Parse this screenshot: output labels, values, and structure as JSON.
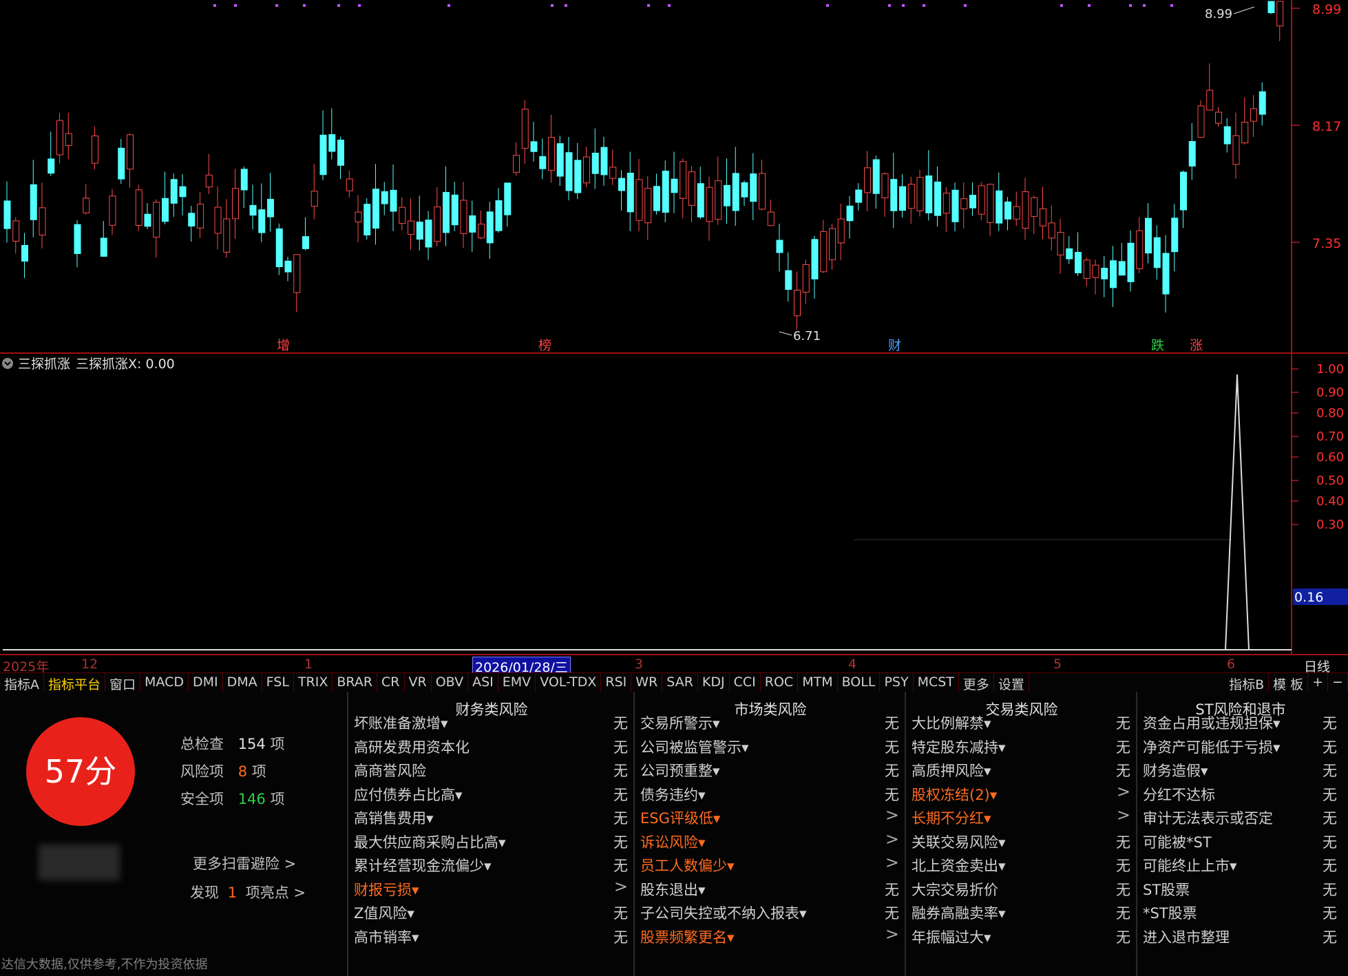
{
  "price_axis": {
    "top_value": "8.99",
    "mid_value": "8.17",
    "low_value": "7.35"
  },
  "price_annotations": {
    "high_label": "8.99",
    "low_label": "6.71"
  },
  "event_markers": [
    {
      "label": "增",
      "color": "#ff4040"
    },
    {
      "label": "榜",
      "color": "#ff4040"
    },
    {
      "label": "财",
      "color": "#4aa0ff"
    },
    {
      "label": "跌",
      "color": "#2ad04a"
    },
    {
      "label": "涨",
      "color": "#ff4040"
    }
  ],
  "indicator": {
    "title": "三探抓涨",
    "value_text": "三探抓涨X: 0.00",
    "axis_ticks": [
      "1.00",
      "0.90",
      "0.80",
      "0.70",
      "0.60",
      "0.50",
      "0.40",
      "0.30"
    ],
    "current_value": "0.16"
  },
  "time_axis": {
    "labels": [
      "2025年",
      "12",
      "1",
      "2026/01/28/三",
      "3",
      "4",
      "5",
      "6"
    ],
    "period": "日线"
  },
  "tabs": [
    "指标A",
    "指标平台",
    "窗口",
    "MACD",
    "DMI",
    "DMA",
    "FSL",
    "TRIX",
    "BRAR",
    "CR",
    "VR",
    "OBV",
    "ASI",
    "EMV",
    "VOL-TDX",
    "RSI",
    "WR",
    "SAR",
    "KDJ",
    "CCI",
    "ROC",
    "MTM",
    "BOLL",
    "PSY",
    "MCST",
    "更多",
    "设置"
  ],
  "tabs_right": [
    "指标B",
    "模 板",
    "+",
    "−"
  ],
  "score": {
    "text": "57分",
    "total_label": "总检查",
    "total_value": "154",
    "unit": "项",
    "risk_label": "风险项",
    "risk_value": "8",
    "safe_label": "安全项",
    "safe_value": "146",
    "more_link": "更多扫雷避险 >",
    "found_prefix": "发现",
    "found_value": "1",
    "found_suffix": "项亮点 >",
    "disclaimer": "达信大数据,仅供参考,不作为投资依据"
  },
  "columns": [
    {
      "title": "财务类风险",
      "rows": [
        {
          "label": "坏账准备激增▾",
          "value": "无",
          "warn": false
        },
        {
          "label": "高研发费用资本化",
          "value": "无",
          "warn": false
        },
        {
          "label": "高商誉风险",
          "value": "无",
          "warn": false
        },
        {
          "label": "应付债券占比高▾",
          "value": "无",
          "warn": false
        },
        {
          "label": "高销售费用▾",
          "value": "无",
          "warn": false
        },
        {
          "label": "最大供应商采购占比高▾",
          "value": "无",
          "warn": false
        },
        {
          "label": "累计经营现金流偏少▾",
          "value": "无",
          "warn": false
        },
        {
          "label": "财报亏损▾",
          "value": ">",
          "warn": true
        },
        {
          "label": "Z值风险▾",
          "value": "无",
          "warn": false
        },
        {
          "label": "高市销率▾",
          "value": "无",
          "warn": false
        }
      ]
    },
    {
      "title": "市场类风险",
      "rows": [
        {
          "label": "交易所警示▾",
          "value": "无",
          "warn": false
        },
        {
          "label": "公司被监管警示▾",
          "value": "无",
          "warn": false
        },
        {
          "label": "公司预重整▾",
          "value": "无",
          "warn": false
        },
        {
          "label": "债务违约▾",
          "value": "无",
          "warn": false
        },
        {
          "label": "ESG评级低▾",
          "value": ">",
          "warn": true
        },
        {
          "label": "诉讼风险▾",
          "value": ">",
          "warn": true
        },
        {
          "label": "员工人数偏少▾",
          "value": ">",
          "warn": true
        },
        {
          "label": "股东退出▾",
          "value": "无",
          "warn": false
        },
        {
          "label": "子公司失控或不纳入报表▾",
          "value": "无",
          "warn": false
        },
        {
          "label": "股票频繁更名▾",
          "value": ">",
          "warn": true
        }
      ]
    },
    {
      "title": "交易类风险",
      "rows": [
        {
          "label": "大比例解禁▾",
          "value": "无",
          "warn": false
        },
        {
          "label": "特定股东减持▾",
          "value": "无",
          "warn": false
        },
        {
          "label": "高质押风险▾",
          "value": "无",
          "warn": false
        },
        {
          "label": "股权冻结(2)▾",
          "value": ">",
          "warn": true
        },
        {
          "label": "长期不分红▾",
          "value": ">",
          "warn": true
        },
        {
          "label": "关联交易风险▾",
          "value": "无",
          "warn": false
        },
        {
          "label": "北上资金卖出▾",
          "value": "无",
          "warn": false
        },
        {
          "label": "大宗交易折价",
          "value": "无",
          "warn": false
        },
        {
          "label": "融券高融卖率▾",
          "value": "无",
          "warn": false
        },
        {
          "label": "年振幅过大▾",
          "value": "无",
          "warn": false
        }
      ]
    },
    {
      "title": "ST风险和退市",
      "rows": [
        {
          "label": "资金占用或违规担保▾",
          "value": "无",
          "warn": false
        },
        {
          "label": "净资产可能低于亏损▾",
          "value": "无",
          "warn": false
        },
        {
          "label": "财务造假▾",
          "value": "无",
          "warn": false
        },
        {
          "label": "分红不达标",
          "value": "无",
          "warn": false
        },
        {
          "label": "审计无法表示或否定",
          "value": "无",
          "warn": false
        },
        {
          "label": "可能被*ST",
          "value": "无",
          "warn": false
        },
        {
          "label": "可能终止上市▾",
          "value": "无",
          "warn": false
        },
        {
          "label": "ST股票",
          "value": "无",
          "warn": false
        },
        {
          "label": "*ST股票",
          "value": "无",
          "warn": false
        },
        {
          "label": "进入退市整理",
          "value": "无",
          "warn": false
        }
      ]
    }
  ],
  "colors": {
    "up": "#ff4a4a",
    "down": "#54ffff",
    "axis": "#ff2a2a",
    "warn": "#ff6a1f",
    "score": "#e8221b"
  }
}
